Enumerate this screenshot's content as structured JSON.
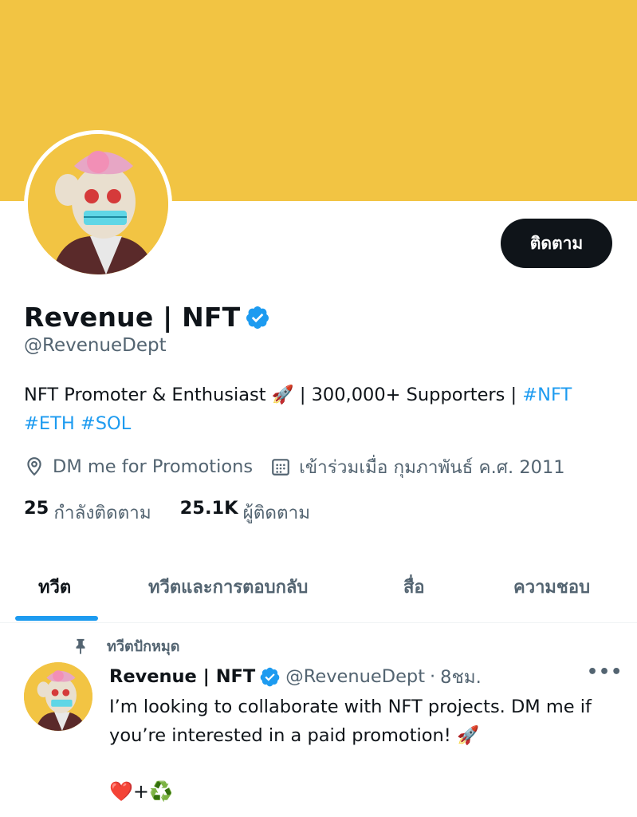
{
  "profile": {
    "name": "Revenue | NFT",
    "handle": "@RevenueDept",
    "follow_label": "ติดตาม",
    "bio_text": "NFT Promoter & Enthusiast 🚀 | 300,000+ Supporters | ",
    "bio_tags": [
      "#NFT",
      "#ETH",
      "#SOL"
    ],
    "location": "DM me for Promotions",
    "joined": "เข้าร่วมเมื่อ กุมภาพันธ์ ค.ศ. 2011",
    "following_count": "25",
    "following_label": "กำลังติดตาม",
    "followers_count": "25.1K",
    "followers_label": "ผู้ติดตาม"
  },
  "tabs": [
    {
      "label": "ทวีต",
      "active": true
    },
    {
      "label": "ทวีตและการตอบกลับ",
      "active": false
    },
    {
      "label": "สื่อ",
      "active": false
    },
    {
      "label": "ความชอบ",
      "active": false
    }
  ],
  "pinned_tweet": {
    "pin_label": "ทวีตปักหมุด",
    "name": "Revenue | NFT",
    "handle": "@RevenueDept",
    "separator": "·",
    "time": "8ชม.",
    "more": "•••",
    "text": "I’m looking to collaborate with NFT projects. DM me if you’re interested in a paid promotion! 🚀",
    "emoji_line": "❤️+♻️"
  },
  "colors": {
    "banner": "#f2c443",
    "accent": "#1d9bf0",
    "muted": "#536471",
    "text": "#0f1419"
  },
  "icons": [
    "verified-badge-icon",
    "location-pin-icon",
    "calendar-icon",
    "pin-icon"
  ]
}
